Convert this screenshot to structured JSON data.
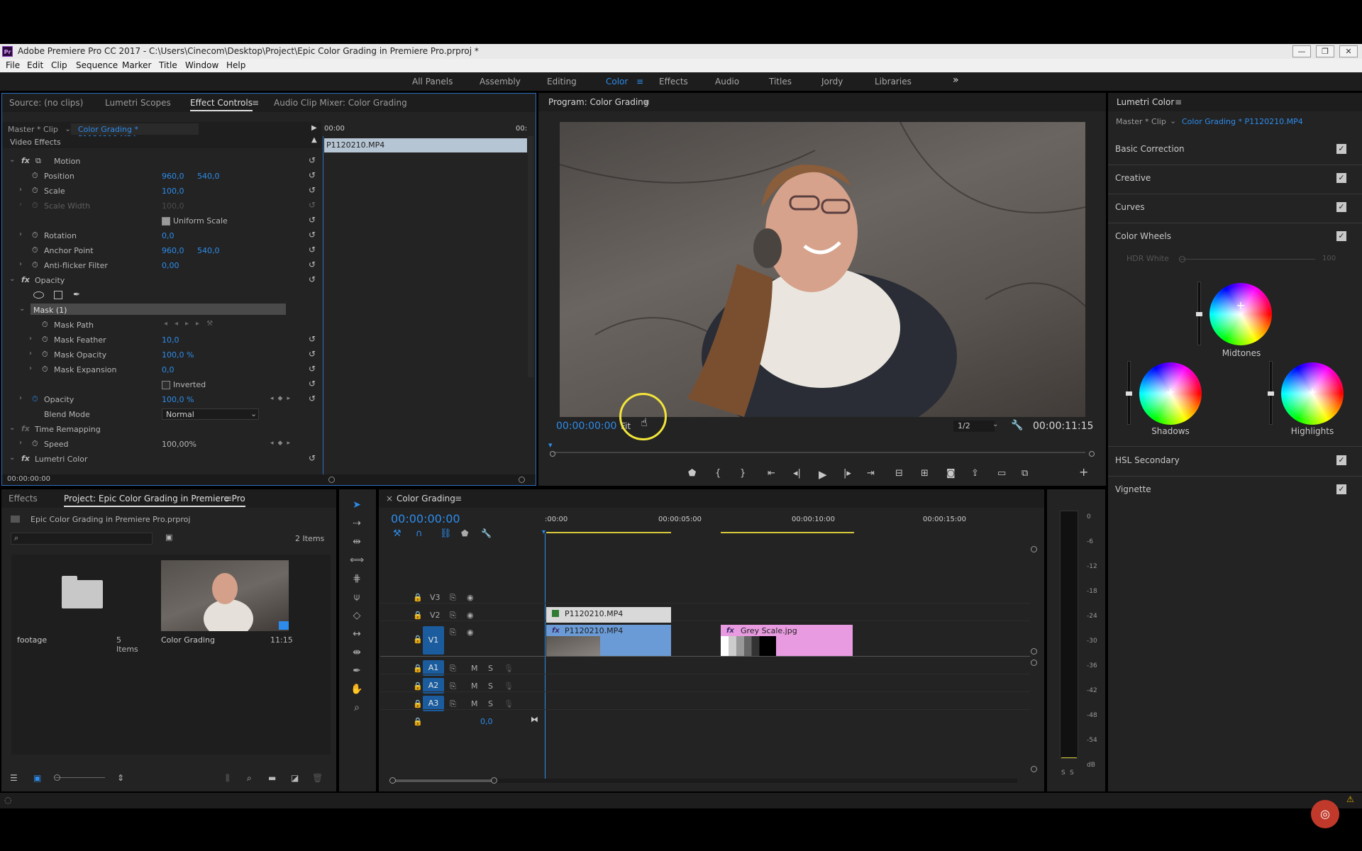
{
  "window": {
    "app_icon": "Pr",
    "title": "Adobe Premiere Pro CC 2017 - C:\\Users\\Cinecom\\Desktop\\Project\\Epic Color Grading in Premiere Pro.prproj *",
    "controls": [
      "—",
      "❐",
      "✕"
    ]
  },
  "menu": [
    "File",
    "Edit",
    "Clip",
    "Sequence",
    "Marker",
    "Title",
    "Window",
    "Help"
  ],
  "workspaces": {
    "items": [
      "All Panels",
      "Assembly",
      "Editing",
      "Color",
      "Effects",
      "Audio",
      "Titles",
      "Jordy",
      "Libraries"
    ],
    "active": "Color",
    "more": "»"
  },
  "effect_controls": {
    "tabs": [
      "Source: (no clips)",
      "Lumetri Scopes",
      "Effect Controls",
      "Audio Clip Mixer: Color Grading"
    ],
    "active_tab": "Effect Controls",
    "clip_label": "Master * Clip",
    "clip_name": "Color Grading * P1120210.MP4",
    "timeline_start": "00:00",
    "timeline_end": "00:",
    "clip_bar": "P1120210.MP4",
    "video_effects": "Video Effects",
    "rows": {
      "motion": "Motion",
      "position": {
        "label": "Position",
        "x": "960,0",
        "y": "540,0"
      },
      "scale": {
        "label": "Scale",
        "value": "100,0"
      },
      "scale_width": {
        "label": "Scale Width",
        "value": "100,0"
      },
      "uniform_scale": "Uniform Scale",
      "rotation": {
        "label": "Rotation",
        "value": "0,0"
      },
      "anchor_point": {
        "label": "Anchor Point",
        "x": "960,0",
        "y": "540,0"
      },
      "anti_flicker": {
        "label": "Anti-flicker Filter",
        "value": "0,00"
      },
      "opacity_group": "Opacity",
      "mask": "Mask (1)",
      "mask_path": "Mask Path",
      "mask_feather": {
        "label": "Mask Feather",
        "value": "10,0"
      },
      "mask_opacity": {
        "label": "Mask Opacity",
        "value": "100,0 %"
      },
      "mask_expansion": {
        "label": "Mask Expansion",
        "value": "0,0"
      },
      "inverted": "Inverted",
      "opacity": {
        "label": "Opacity",
        "value": "100,0 %"
      },
      "blend_mode": {
        "label": "Blend Mode",
        "value": "Normal"
      },
      "time_remapping": "Time Remapping",
      "speed": {
        "label": "Speed",
        "value": "100,00%"
      },
      "lumetri": "Lumetri Color"
    },
    "current_time": "00:00:00:00"
  },
  "program": {
    "title": "Program: Color Grading",
    "timecode": "00:00:00:00",
    "fit": "Fit",
    "resolution": "1/2",
    "duration": "00:00:11:15"
  },
  "lumetri": {
    "title": "Lumetri Color",
    "clip_label": "Master * Clip",
    "clip_name": "Color Grading * P1120210.MP4",
    "sections": [
      "Basic Correction",
      "Creative",
      "Curves",
      "Color Wheels",
      "HSL Secondary",
      "Vignette"
    ],
    "hdr_white": {
      "label": "HDR White",
      "value": "100"
    },
    "wheels": [
      "Midtones",
      "Shadows",
      "Highlights"
    ],
    "check": "✓"
  },
  "project": {
    "tabs": [
      "Effects",
      "Project: Epic Color Grading in Premiere Pro"
    ],
    "active_tab": "Project: Epic Color Grading in Premiere Pro",
    "file": "Epic Color Grading in Premiere Pro.prproj",
    "item_count": "2 Items",
    "items": [
      {
        "name": "footage",
        "meta": "5 Items"
      },
      {
        "name": "Color Grading",
        "meta": "11:15"
      }
    ]
  },
  "timeline": {
    "title": "Color Grading",
    "timecode": "00:00:00:00",
    "ruler": [
      ":00:00",
      "00:00:05:00",
      "00:00:10:00",
      "00:00:15:00"
    ],
    "video_tracks": [
      "V3",
      "V2",
      "V1"
    ],
    "audio_tracks": [
      "A1",
      "A2",
      "A3"
    ],
    "audio_btn_m": "M",
    "audio_btn_s": "S",
    "master_value": "0,0",
    "clips": {
      "v2": "P1120210.MP4",
      "v1_a": "P1120210.MP4",
      "v1_b": "Grey Scale.jpg"
    }
  },
  "meter": {
    "scale": [
      "0",
      "-6",
      "-12",
      "-18",
      "-24",
      "-30",
      "-36",
      "-42",
      "-48",
      "-54",
      "dB"
    ],
    "solo": [
      "S",
      "S"
    ]
  },
  "colors": {
    "accent": "#2d8ceb",
    "panel": "#232323",
    "header": "#1d1d1d",
    "clip_blue": "#6b9bd6",
    "clip_pink": "#e89be0",
    "track_target": "#1a5c9e"
  }
}
